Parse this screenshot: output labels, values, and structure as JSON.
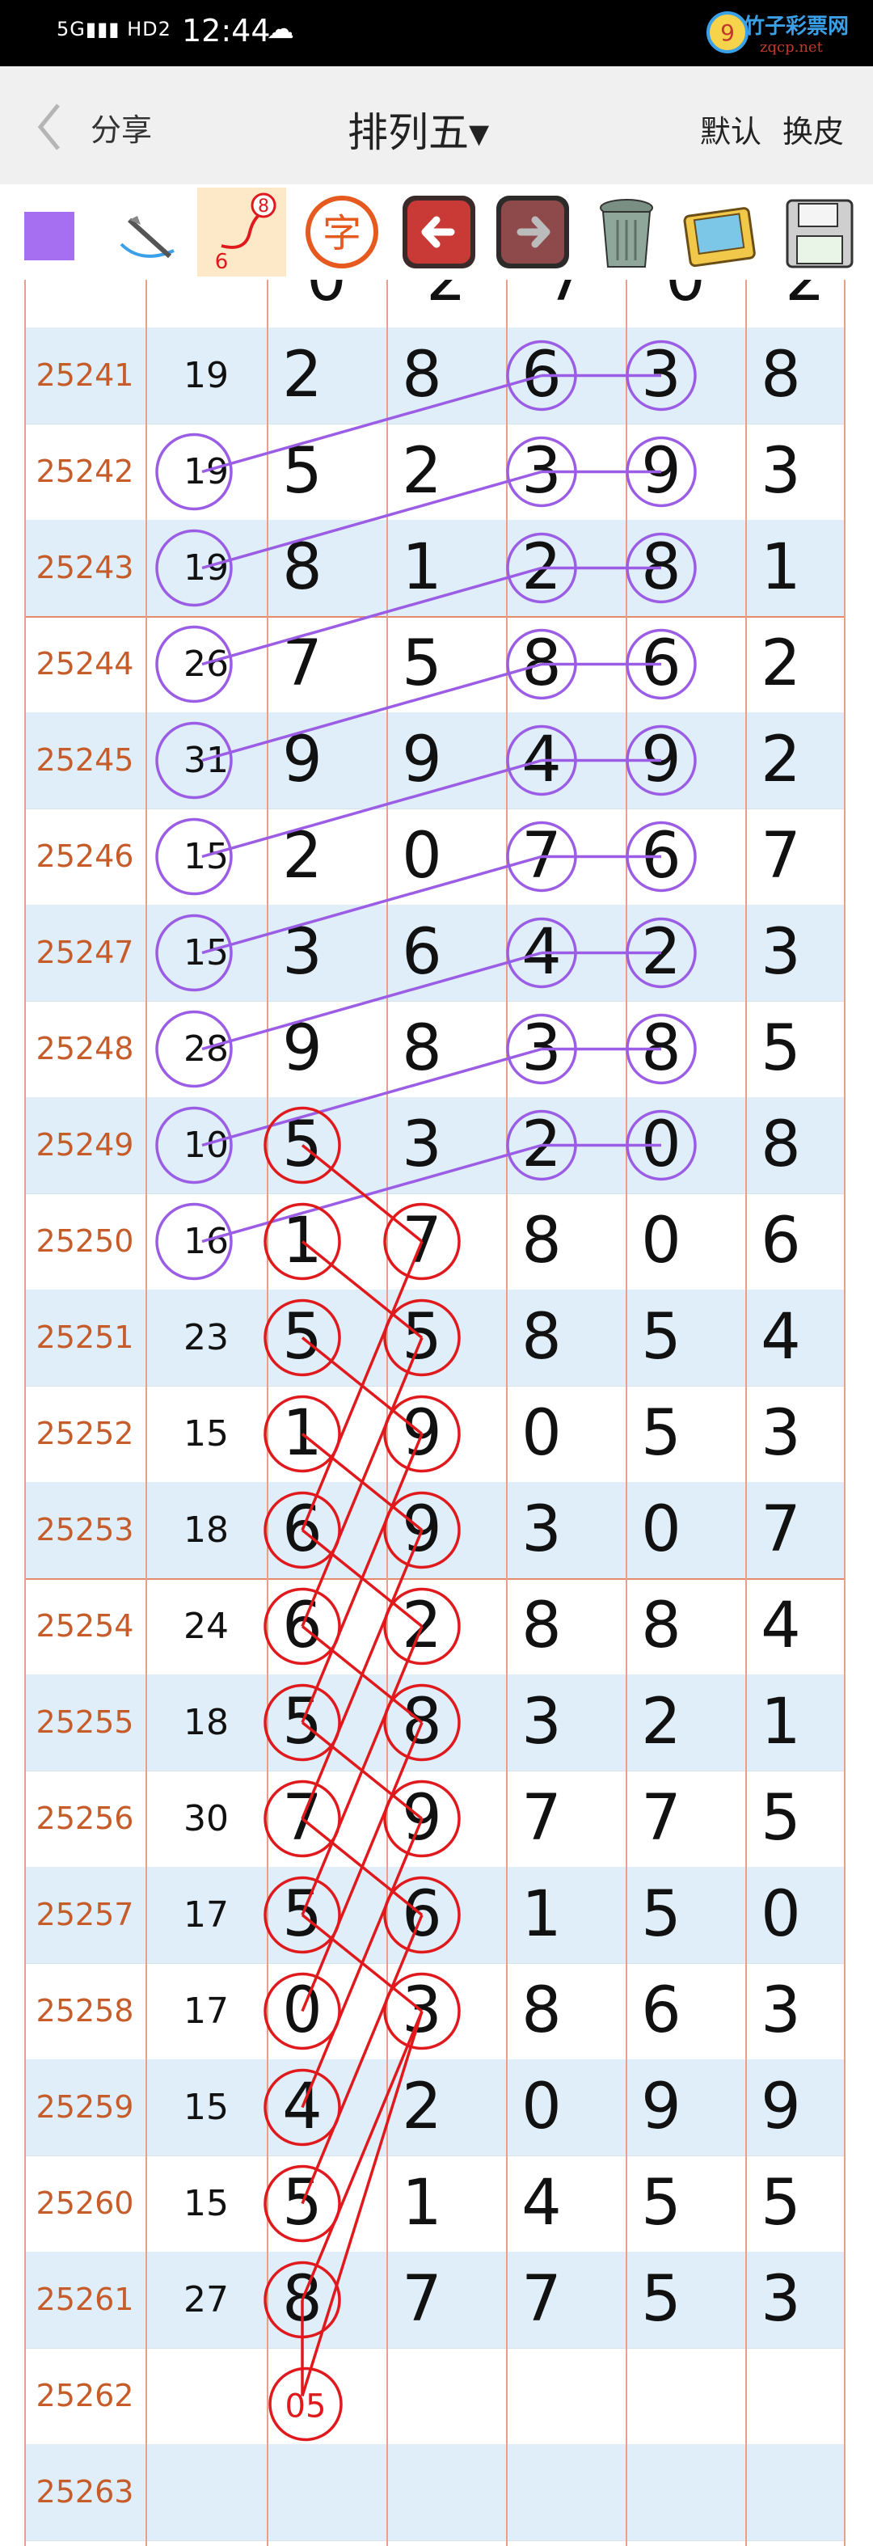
{
  "status": {
    "time": "12:44",
    "signal": "5G",
    "hd": "HD2"
  },
  "watermark": {
    "name": "竹子彩票网",
    "domain": "zqcp.net"
  },
  "nav": {
    "back_label": "分享",
    "title": "排列五▾",
    "default_label": "默认",
    "skin_label": "换皮"
  },
  "toolbar": {
    "tools": [
      {
        "icon": "purple-square-icon"
      },
      {
        "icon": "pen-icon"
      },
      {
        "icon": "number-curve-icon"
      },
      {
        "icon": "char-icon",
        "label": "字"
      },
      {
        "icon": "undo-arrow-icon"
      },
      {
        "icon": "redo-arrow-icon"
      },
      {
        "icon": "trash-icon"
      },
      {
        "icon": "gallery-icon"
      },
      {
        "icon": "save-icon"
      }
    ]
  },
  "top_partial": [
    "0",
    "2",
    "7",
    "0",
    "2"
  ],
  "rows": [
    {
      "issue": "25241",
      "sum": "19",
      "d": [
        "2",
        "8",
        "6",
        "3",
        "8"
      ]
    },
    {
      "issue": "25242",
      "sum": "19",
      "d": [
        "5",
        "2",
        "3",
        "9",
        "3"
      ]
    },
    {
      "issue": "25243",
      "sum": "19",
      "d": [
        "8",
        "1",
        "2",
        "8",
        "1"
      ]
    },
    {
      "issue": "25244",
      "sum": "26",
      "d": [
        "7",
        "5",
        "8",
        "6",
        "2"
      ]
    },
    {
      "issue": "25245",
      "sum": "31",
      "d": [
        "9",
        "9",
        "4",
        "9",
        "2"
      ]
    },
    {
      "issue": "25246",
      "sum": "15",
      "d": [
        "2",
        "0",
        "7",
        "6",
        "7"
      ]
    },
    {
      "issue": "25247",
      "sum": "15",
      "d": [
        "3",
        "6",
        "4",
        "2",
        "3"
      ]
    },
    {
      "issue": "25248",
      "sum": "28",
      "d": [
        "9",
        "8",
        "3",
        "8",
        "5"
      ]
    },
    {
      "issue": "25249",
      "sum": "10",
      "d": [
        "5",
        "3",
        "2",
        "0",
        "8"
      ]
    },
    {
      "issue": "25250",
      "sum": "16",
      "d": [
        "1",
        "7",
        "8",
        "0",
        "6"
      ]
    },
    {
      "issue": "25251",
      "sum": "23",
      "d": [
        "5",
        "5",
        "8",
        "5",
        "4"
      ]
    },
    {
      "issue": "25252",
      "sum": "15",
      "d": [
        "1",
        "9",
        "0",
        "5",
        "3"
      ]
    },
    {
      "issue": "25253",
      "sum": "18",
      "d": [
        "6",
        "9",
        "3",
        "0",
        "7"
      ]
    },
    {
      "issue": "25254",
      "sum": "24",
      "d": [
        "6",
        "2",
        "8",
        "8",
        "4"
      ]
    },
    {
      "issue": "25255",
      "sum": "18",
      "d": [
        "5",
        "8",
        "3",
        "2",
        "1"
      ]
    },
    {
      "issue": "25256",
      "sum": "30",
      "d": [
        "7",
        "9",
        "7",
        "7",
        "5"
      ]
    },
    {
      "issue": "25257",
      "sum": "17",
      "d": [
        "5",
        "6",
        "1",
        "5",
        "0"
      ]
    },
    {
      "issue": "25258",
      "sum": "17",
      "d": [
        "0",
        "3",
        "8",
        "6",
        "3"
      ]
    },
    {
      "issue": "25259",
      "sum": "15",
      "d": [
        "4",
        "2",
        "0",
        "9",
        "9"
      ]
    },
    {
      "issue": "25260",
      "sum": "15",
      "d": [
        "5",
        "1",
        "4",
        "5",
        "5"
      ]
    },
    {
      "issue": "25261",
      "sum": "27",
      "d": [
        "8",
        "7",
        "7",
        "5",
        "3"
      ]
    },
    {
      "issue": "25262",
      "sum": "",
      "d": [
        "",
        "",
        "",
        "",
        ""
      ]
    },
    {
      "issue": "25263",
      "sum": "",
      "d": [
        "",
        "",
        "",
        "",
        ""
      ]
    }
  ],
  "annotation": {
    "prediction": "05"
  },
  "colors": {
    "purple": "#9b5de5",
    "red": "#e0191d",
    "issue": "#c65c2a",
    "alt_row": "#dfeef8"
  }
}
